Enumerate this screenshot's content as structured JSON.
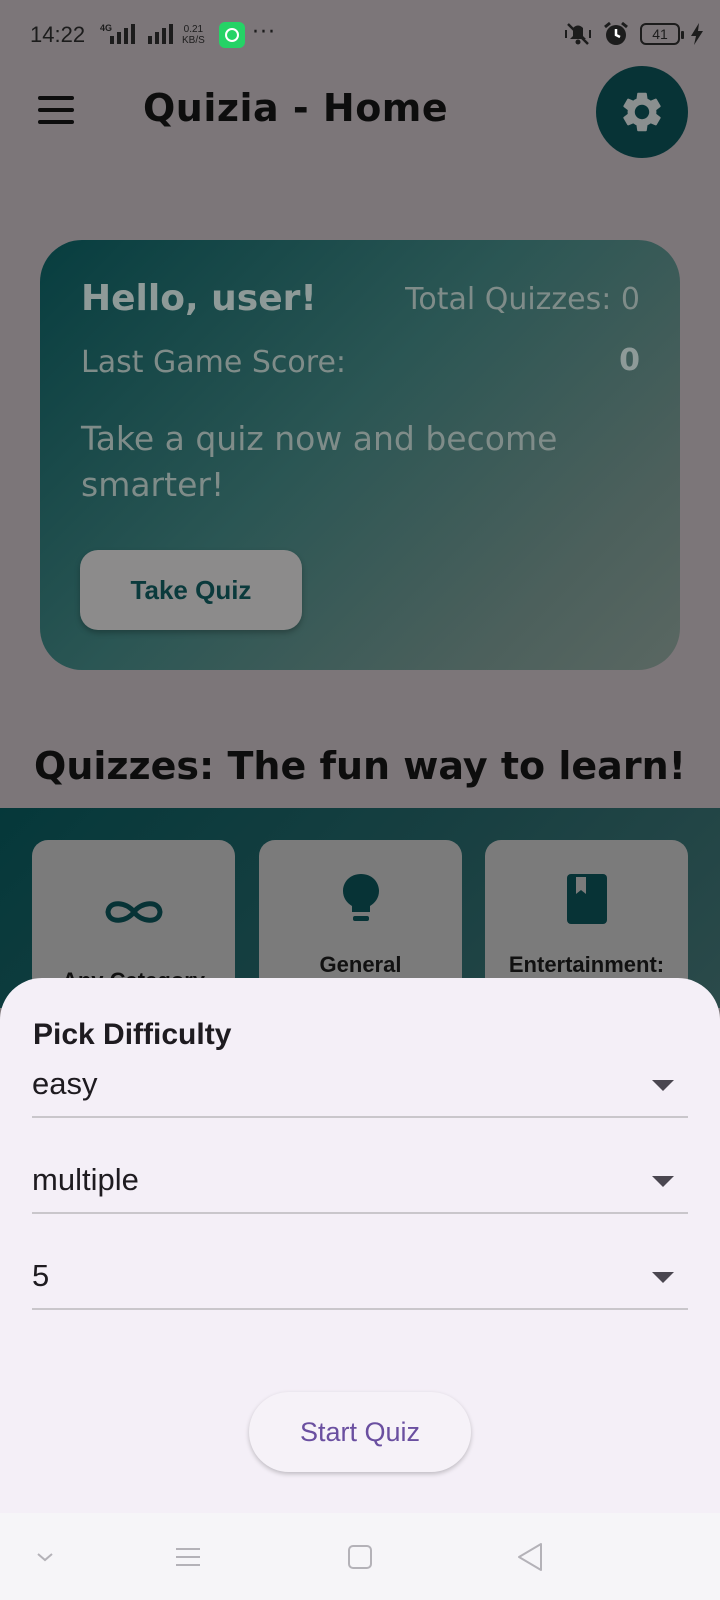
{
  "status_bar": {
    "time": "14:22",
    "network_type": "4G",
    "data_speed_value": "0.21",
    "data_speed_unit": "KB/S",
    "overflow": "···",
    "battery_level": "41",
    "icons": [
      "signal-icon",
      "whatsapp-icon",
      "mute-vibrate-icon",
      "alarm-icon",
      "battery-icon",
      "charging-icon"
    ]
  },
  "app_bar": {
    "title": "Quizia - Home",
    "menu_icon": "hamburger-menu-icon",
    "settings_icon": "gear-icon"
  },
  "hero": {
    "greeting": "Hello, user!",
    "total_quizzes": "Total Quizzes: 0",
    "last_score_label": "Last Game Score:",
    "last_score_value": "0",
    "tagline": "Take a quiz now and become smarter!",
    "take_quiz_label": "Take Quiz"
  },
  "section_title": "Quizzes: The fun way to learn!",
  "categories": [
    {
      "label": "Any Category",
      "icon": "infinity-icon"
    },
    {
      "label": "General",
      "icon": "lightbulb-icon"
    },
    {
      "label": "Entertainment:",
      "icon": "book-icon"
    }
  ],
  "sheet": {
    "title": "Pick Difficulty",
    "difficulty": "easy",
    "question_type": "multiple",
    "question_count": "5",
    "start_label": "Start Quiz"
  },
  "nav_bar": {
    "buttons": [
      "nav-collapse-icon",
      "nav-recents-icon",
      "nav-home-icon",
      "nav-back-icon"
    ]
  },
  "colors": {
    "scrim": "#7c7676",
    "teal_dark": "#073336",
    "sheet_bg": "#f4eff7",
    "accent_purple": "#6a4fa0"
  }
}
